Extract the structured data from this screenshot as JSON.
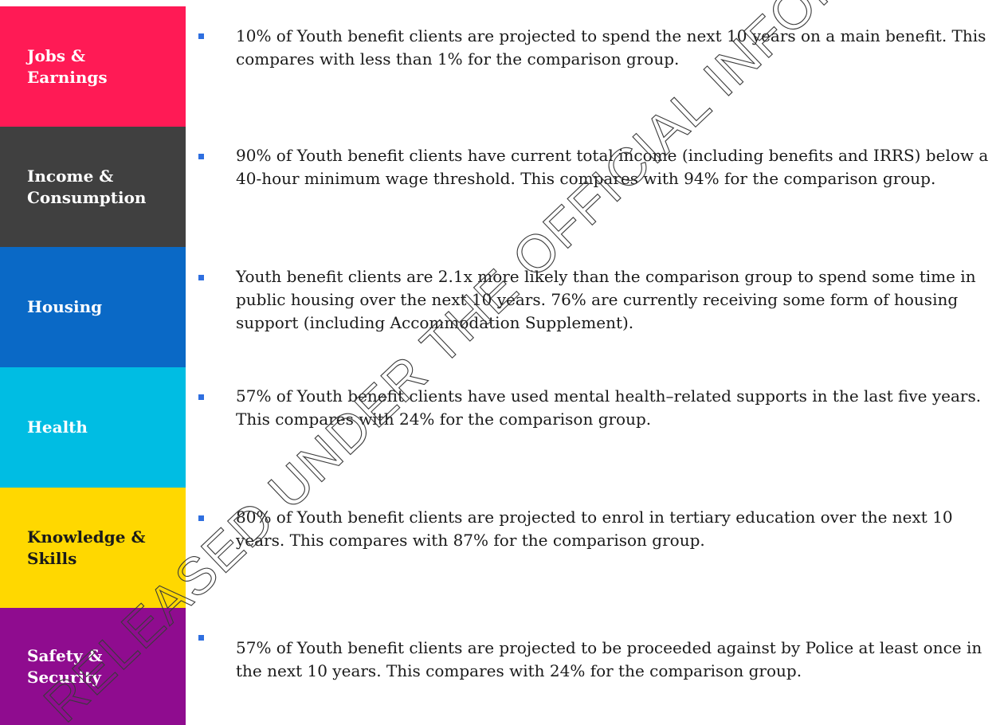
{
  "rows": [
    {
      "label": "Jobs &\nEarnings",
      "color": "#ff1a55",
      "label_color": "#ffffff",
      "text": "10% of Youth benefit clients are projected to spend the next 10 years on a main benefit. This compares with less than 1% for the comparison group."
    },
    {
      "label": "Income &\nConsumption",
      "color": "#404040",
      "label_color": "#ffffff",
      "text": "90% of Youth benefit clients have current total income (including benefits and IRRS) below a 40-hour minimum wage threshold. This compares with 94% for the comparison group."
    },
    {
      "label": "Housing",
      "color": "#0a69c6",
      "label_color": "#ffffff",
      "text": "Youth benefit clients are 2.1x more likely than the comparison group to spend some time in public housing over the next 10 years. 76% are currently receiving some form of housing support (including Accommodation Supplement)."
    },
    {
      "label": "Health",
      "color": "#00bde3",
      "label_color": "#ffffff",
      "text": "57% of Youth benefit clients have used mental health–related supports in the last five years. This compares with 24% for the comparison group."
    },
    {
      "label": "Knowledge &\nSkills",
      "color": "#ffd800",
      "label_color": "#1a1a1a",
      "text": "80% of Youth benefit clients are projected to enrol in tertiary education over the next 10 years. This compares with 87% for the comparison group."
    },
    {
      "label": "Safety &\nSecurity",
      "color": "#8f0c8f",
      "label_color": "#ffffff",
      "text": "57% of Youth benefit clients are projected to be proceeded against by Police at least once in the next 10 years. This compares with 24% for the comparison group."
    }
  ],
  "watermark": "RELEASED UNDER THE OFFICIAL INFORMATION ACT"
}
